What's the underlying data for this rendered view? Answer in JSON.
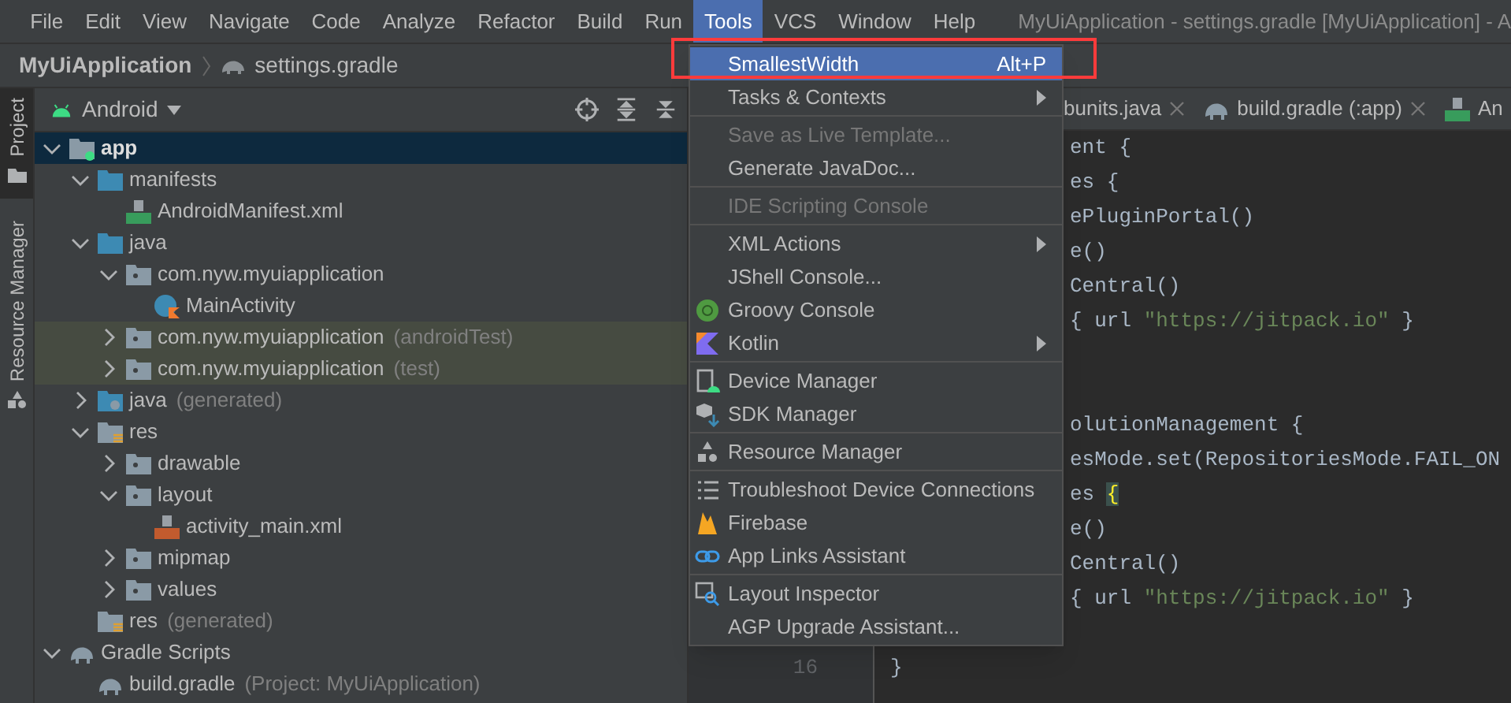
{
  "menu_bar": [
    {
      "label": "File",
      "selected": false
    },
    {
      "label": "Edit",
      "selected": false
    },
    {
      "label": "View",
      "selected": false
    },
    {
      "label": "Navigate",
      "selected": false
    },
    {
      "label": "Code",
      "selected": false
    },
    {
      "label": "Analyze",
      "selected": false
    },
    {
      "label": "Refactor",
      "selected": false
    },
    {
      "label": "Build",
      "selected": false
    },
    {
      "label": "Run",
      "selected": false
    },
    {
      "label": "Tools",
      "selected": true
    },
    {
      "label": "VCS",
      "selected": false
    },
    {
      "label": "Window",
      "selected": false
    },
    {
      "label": "Help",
      "selected": false
    }
  ],
  "window": {
    "title": "MyUiApplication - settings.gradle [MyUiApplication] - A"
  },
  "breadcrumb": {
    "project": "MyUiApplication",
    "file": "settings.gradle"
  },
  "tool_strip": [
    {
      "label": "Project",
      "selected": true
    },
    {
      "label": "Resource Manager",
      "selected": false
    }
  ],
  "project_panel": {
    "view": "Android",
    "tree": [
      {
        "label": "app",
        "kind": "module",
        "expanded": true,
        "selected": true,
        "highlighted": false,
        "children": [
          {
            "label": "manifests",
            "kind": "folder",
            "expanded": true,
            "selected": false,
            "highlighted": false,
            "children": [
              {
                "label": "AndroidManifest.xml",
                "kind": "manifest",
                "selected": false,
                "highlighted": false
              }
            ]
          },
          {
            "label": "java",
            "kind": "folder",
            "expanded": true,
            "selected": false,
            "highlighted": false,
            "children": [
              {
                "label": "com.nyw.myuiapplication",
                "kind": "package",
                "expanded": true,
                "selected": false,
                "highlighted": false,
                "children": [
                  {
                    "label": "MainActivity",
                    "kind": "class",
                    "selected": false,
                    "highlighted": false
                  }
                ]
              },
              {
                "label": "com.nyw.myuiapplication",
                "suffix": "(androidTest)",
                "kind": "package",
                "expanded": false,
                "selected": false,
                "highlighted": true
              },
              {
                "label": "com.nyw.myuiapplication",
                "suffix": "(test)",
                "kind": "package",
                "expanded": false,
                "selected": false,
                "highlighted": true
              }
            ]
          },
          {
            "label": "java",
            "suffix": "(generated)",
            "kind": "generated",
            "expanded": false,
            "selected": false,
            "highlighted": false
          },
          {
            "label": "res",
            "kind": "resources",
            "expanded": true,
            "selected": false,
            "highlighted": false,
            "children": [
              {
                "label": "drawable",
                "kind": "package",
                "expanded": false,
                "selected": false,
                "highlighted": false
              },
              {
                "label": "layout",
                "kind": "package",
                "expanded": true,
                "selected": false,
                "highlighted": false,
                "children": [
                  {
                    "label": "activity_main.xml",
                    "kind": "xml",
                    "selected": false,
                    "highlighted": false
                  }
                ]
              },
              {
                "label": "mipmap",
                "kind": "package",
                "expanded": false,
                "selected": false,
                "highlighted": false
              },
              {
                "label": "values",
                "kind": "package",
                "expanded": false,
                "selected": false,
                "highlighted": false
              }
            ]
          },
          {
            "label": "res",
            "suffix": "(generated)",
            "kind": "resources",
            "selected": false,
            "highlighted": false
          }
        ]
      },
      {
        "label": "Gradle Scripts",
        "kind": "gradle",
        "expanded": true,
        "selected": false,
        "highlighted": false,
        "children": [
          {
            "label": "build.gradle",
            "suffix": "(Project: MyUiApplication)",
            "kind": "gradle",
            "selected": false,
            "highlighted": false
          }
        ]
      }
    ]
  },
  "editor_tabs": [
    {
      "label": "bunits.java",
      "kind": "plain"
    },
    {
      "label": "build.gradle (:app)",
      "kind": "gradle"
    },
    {
      "label": "An",
      "kind": "manifest"
    }
  ],
  "code_lines": [
    {
      "kind": "code",
      "segments": [
        {
          "text": "ent {"
        }
      ]
    },
    {
      "kind": "code",
      "segments": [
        {
          "text": "es {"
        }
      ]
    },
    {
      "kind": "code",
      "segments": [
        {
          "text": "ePluginPortal()"
        }
      ]
    },
    {
      "kind": "code",
      "segments": [
        {
          "text": "e()"
        }
      ]
    },
    {
      "kind": "code",
      "segments": [
        {
          "text": "Central()"
        }
      ]
    },
    {
      "kind": "code",
      "segments": [
        {
          "text": "{ url "
        },
        {
          "text": "\"https://jitpack.io\"",
          "kind": "string"
        },
        {
          "text": " }"
        }
      ]
    },
    {
      "kind": "blank"
    },
    {
      "kind": "blank"
    },
    {
      "kind": "code",
      "segments": [
        {
          "text": "olutionManagement {"
        }
      ]
    },
    {
      "kind": "code",
      "segments": [
        {
          "text": "esMode.set(RepositoriesMode.FAIL_ON"
        }
      ]
    },
    {
      "kind": "code",
      "segments": [
        {
          "text": "es "
        },
        {
          "text": "{",
          "kind": "matched_brace"
        }
      ]
    },
    {
      "kind": "code",
      "segments": [
        {
          "text": "e()"
        }
      ]
    },
    {
      "kind": "code",
      "segments": [
        {
          "text": "Central()"
        }
      ]
    },
    {
      "kind": "code",
      "segments": [
        {
          "text": "{ url "
        },
        {
          "text": "\"https://jitpack.io\"",
          "kind": "string"
        },
        {
          "text": " }"
        }
      ]
    },
    {
      "kind": "blank"
    }
  ],
  "last_line": {
    "number": "16",
    "text": "}"
  },
  "tools_menu": [
    {
      "kind": "plain",
      "label": "SmallestWidth",
      "shortcut": "Alt+P",
      "selected": true,
      "annotated": true
    },
    {
      "kind": "plain",
      "label": "Tasks & Contexts",
      "submenu": true,
      "selected": false
    },
    {
      "kind": "separator"
    },
    {
      "kind": "plain",
      "label": "Save as Live Template...",
      "disabled": true,
      "selected": false
    },
    {
      "kind": "plain",
      "label": "Generate JavaDoc...",
      "selected": false
    },
    {
      "kind": "separator"
    },
    {
      "kind": "plain",
      "label": "IDE Scripting Console",
      "disabled": true,
      "selected": false
    },
    {
      "kind": "separator"
    },
    {
      "kind": "plain",
      "label": "XML Actions",
      "submenu": true,
      "selected": false
    },
    {
      "kind": "plain",
      "label": "JShell Console...",
      "selected": false
    },
    {
      "kind": "groovy",
      "label": "Groovy Console",
      "selected": false
    },
    {
      "kind": "kotlin",
      "label": "Kotlin",
      "submenu": true,
      "selected": false
    },
    {
      "kind": "separator"
    },
    {
      "kind": "device",
      "label": "Device Manager",
      "selected": false
    },
    {
      "kind": "sdk",
      "label": "SDK Manager",
      "selected": false
    },
    {
      "kind": "separator"
    },
    {
      "kind": "resources",
      "label": "Resource Manager",
      "selected": false
    },
    {
      "kind": "separator"
    },
    {
      "kind": "list",
      "label": "Troubleshoot Device Connections",
      "selected": false
    },
    {
      "kind": "firebase",
      "label": "Firebase",
      "selected": false
    },
    {
      "kind": "link",
      "label": "App Links Assistant",
      "selected": false
    },
    {
      "kind": "separator"
    },
    {
      "kind": "inspector",
      "label": "Layout Inspector",
      "selected": false
    },
    {
      "kind": "plain",
      "label": "AGP Upgrade Assistant...",
      "selected": false
    }
  ]
}
